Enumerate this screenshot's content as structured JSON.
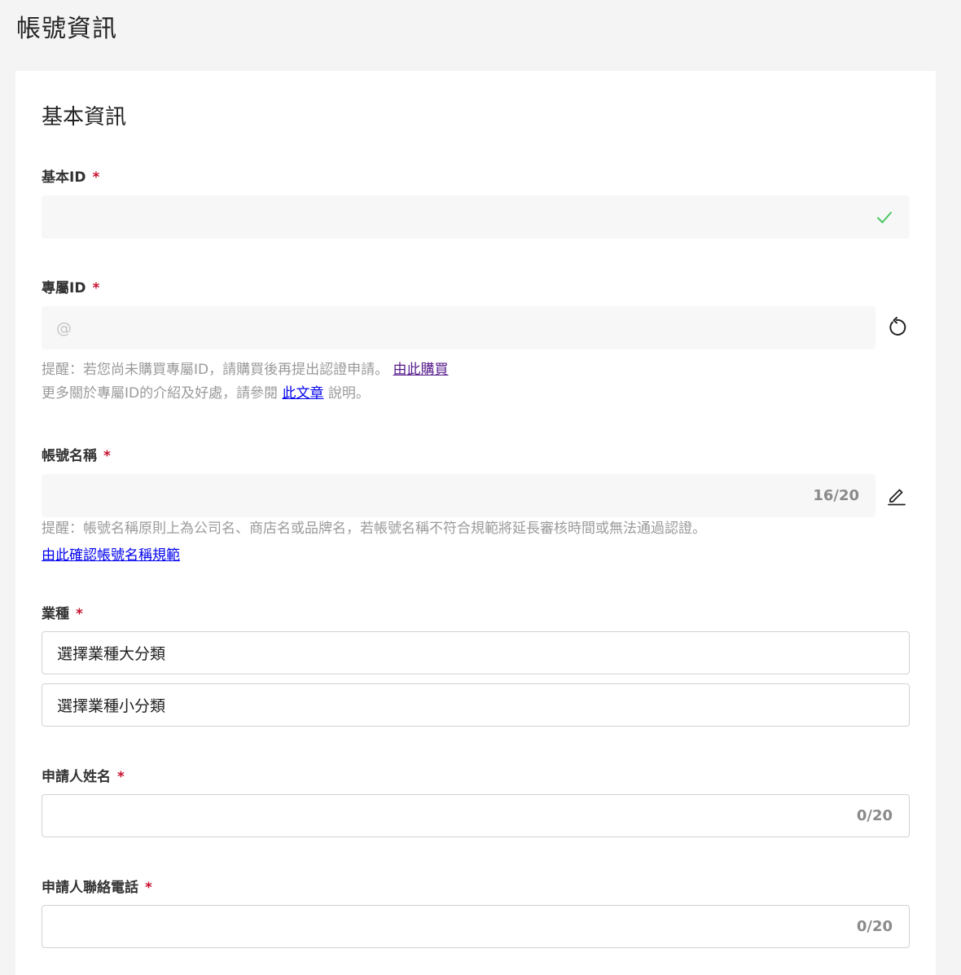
{
  "page": {
    "title": "帳號資訊"
  },
  "section": {
    "title": "基本資訊"
  },
  "fields": {
    "basic_id": {
      "label": "基本ID",
      "required_mark": "*",
      "value": ""
    },
    "premium_id": {
      "label": "專屬ID",
      "required_mark": "*",
      "placeholder": "@",
      "hint_line1_prefix": "提醒：若您尚未購買專屬ID，請購買後再提出認證申請。",
      "buy_link": "由此購買",
      "hint_line2_prefix": "更多關於專屬ID的介紹及好處，請參閱",
      "article_link": "此文章",
      "hint_line2_suffix": "說明。"
    },
    "account_name": {
      "label": "帳號名稱",
      "required_mark": "*",
      "value": "",
      "counter": "16/20",
      "hint": "提醒：帳號名稱原則上為公司名、商店名或品牌名，若帳號名稱不符合規範將延長審核時間或無法通過認證。",
      "rules_link": "由此確認帳號名稱規範"
    },
    "industry": {
      "label": "業種",
      "required_mark": "*",
      "major_select": "選擇業種大分類",
      "minor_select": "選擇業種小分類"
    },
    "applicant_name": {
      "label": "申請人姓名",
      "required_mark": "*",
      "value": "",
      "counter": "0/20"
    },
    "applicant_phone": {
      "label": "申請人聯絡電話",
      "required_mark": "*",
      "value": "",
      "counter": "0/20"
    }
  },
  "colors": {
    "required": "#c8102e",
    "check": "#4cc764",
    "link": "#0000ee",
    "link_visited": "#551a8b"
  },
  "icons": {
    "basic_id_status": "check-icon",
    "premium_id_action": "refresh-icon",
    "account_name_action": "edit-pencil-icon"
  }
}
